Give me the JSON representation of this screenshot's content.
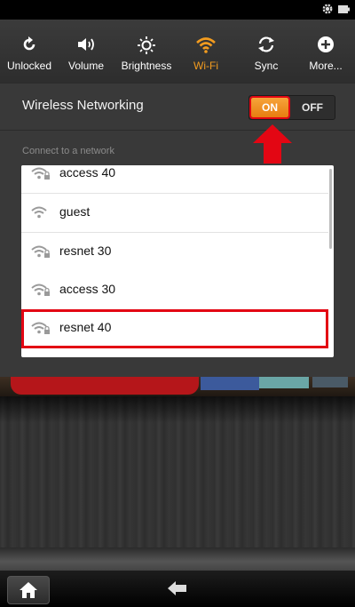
{
  "quick_settings": [
    {
      "label": "Unlocked",
      "icon": "rotate-lock-icon"
    },
    {
      "label": "Volume",
      "icon": "speaker-icon"
    },
    {
      "label": "Brightness",
      "icon": "sun-icon"
    },
    {
      "label": "Wi-Fi",
      "icon": "wifi-icon",
      "active": true
    },
    {
      "label": "Sync",
      "icon": "sync-icon"
    },
    {
      "label": "More...",
      "icon": "plus-icon"
    }
  ],
  "wireless": {
    "label": "Wireless Networking",
    "on_label": "ON",
    "off_label": "OFF",
    "state": "on"
  },
  "connect_label": "Connect to a network",
  "networks": [
    {
      "name": "access 40",
      "secured": true
    },
    {
      "name": "guest",
      "secured": false
    },
    {
      "name": "resnet 30",
      "secured": true
    },
    {
      "name": "access 30",
      "secured": true
    },
    {
      "name": "resnet 40",
      "secured": true,
      "highlighted": true
    }
  ],
  "colors": {
    "accent": "#f39c1f",
    "highlight": "#e30613"
  }
}
